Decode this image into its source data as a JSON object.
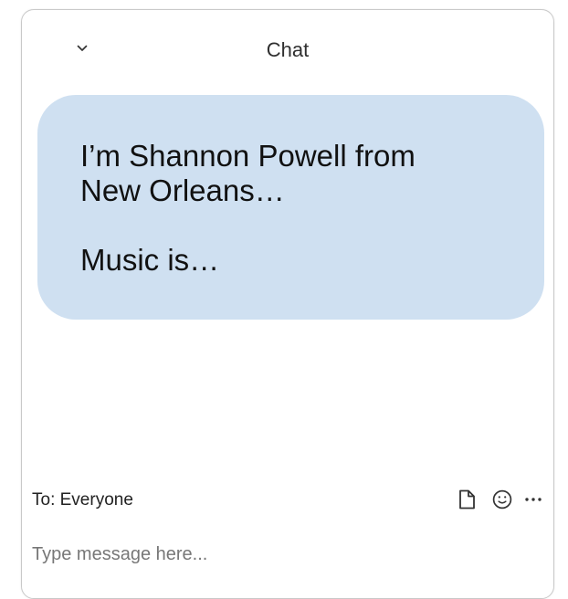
{
  "chat": {
    "title": "Chat",
    "collapse_icon": "chevron-down-icon",
    "message": {
      "line_one": "I’m Shannon Powell from",
      "line_two": "New Orleans…",
      "line_three": "Music is…",
      "background_color": "#cfe0f1"
    },
    "composer": {
      "recipient": "To: Everyone",
      "placeholder": "Type message here...",
      "icons": [
        "file-icon",
        "emoji-icon",
        "more-options-icon"
      ]
    }
  }
}
